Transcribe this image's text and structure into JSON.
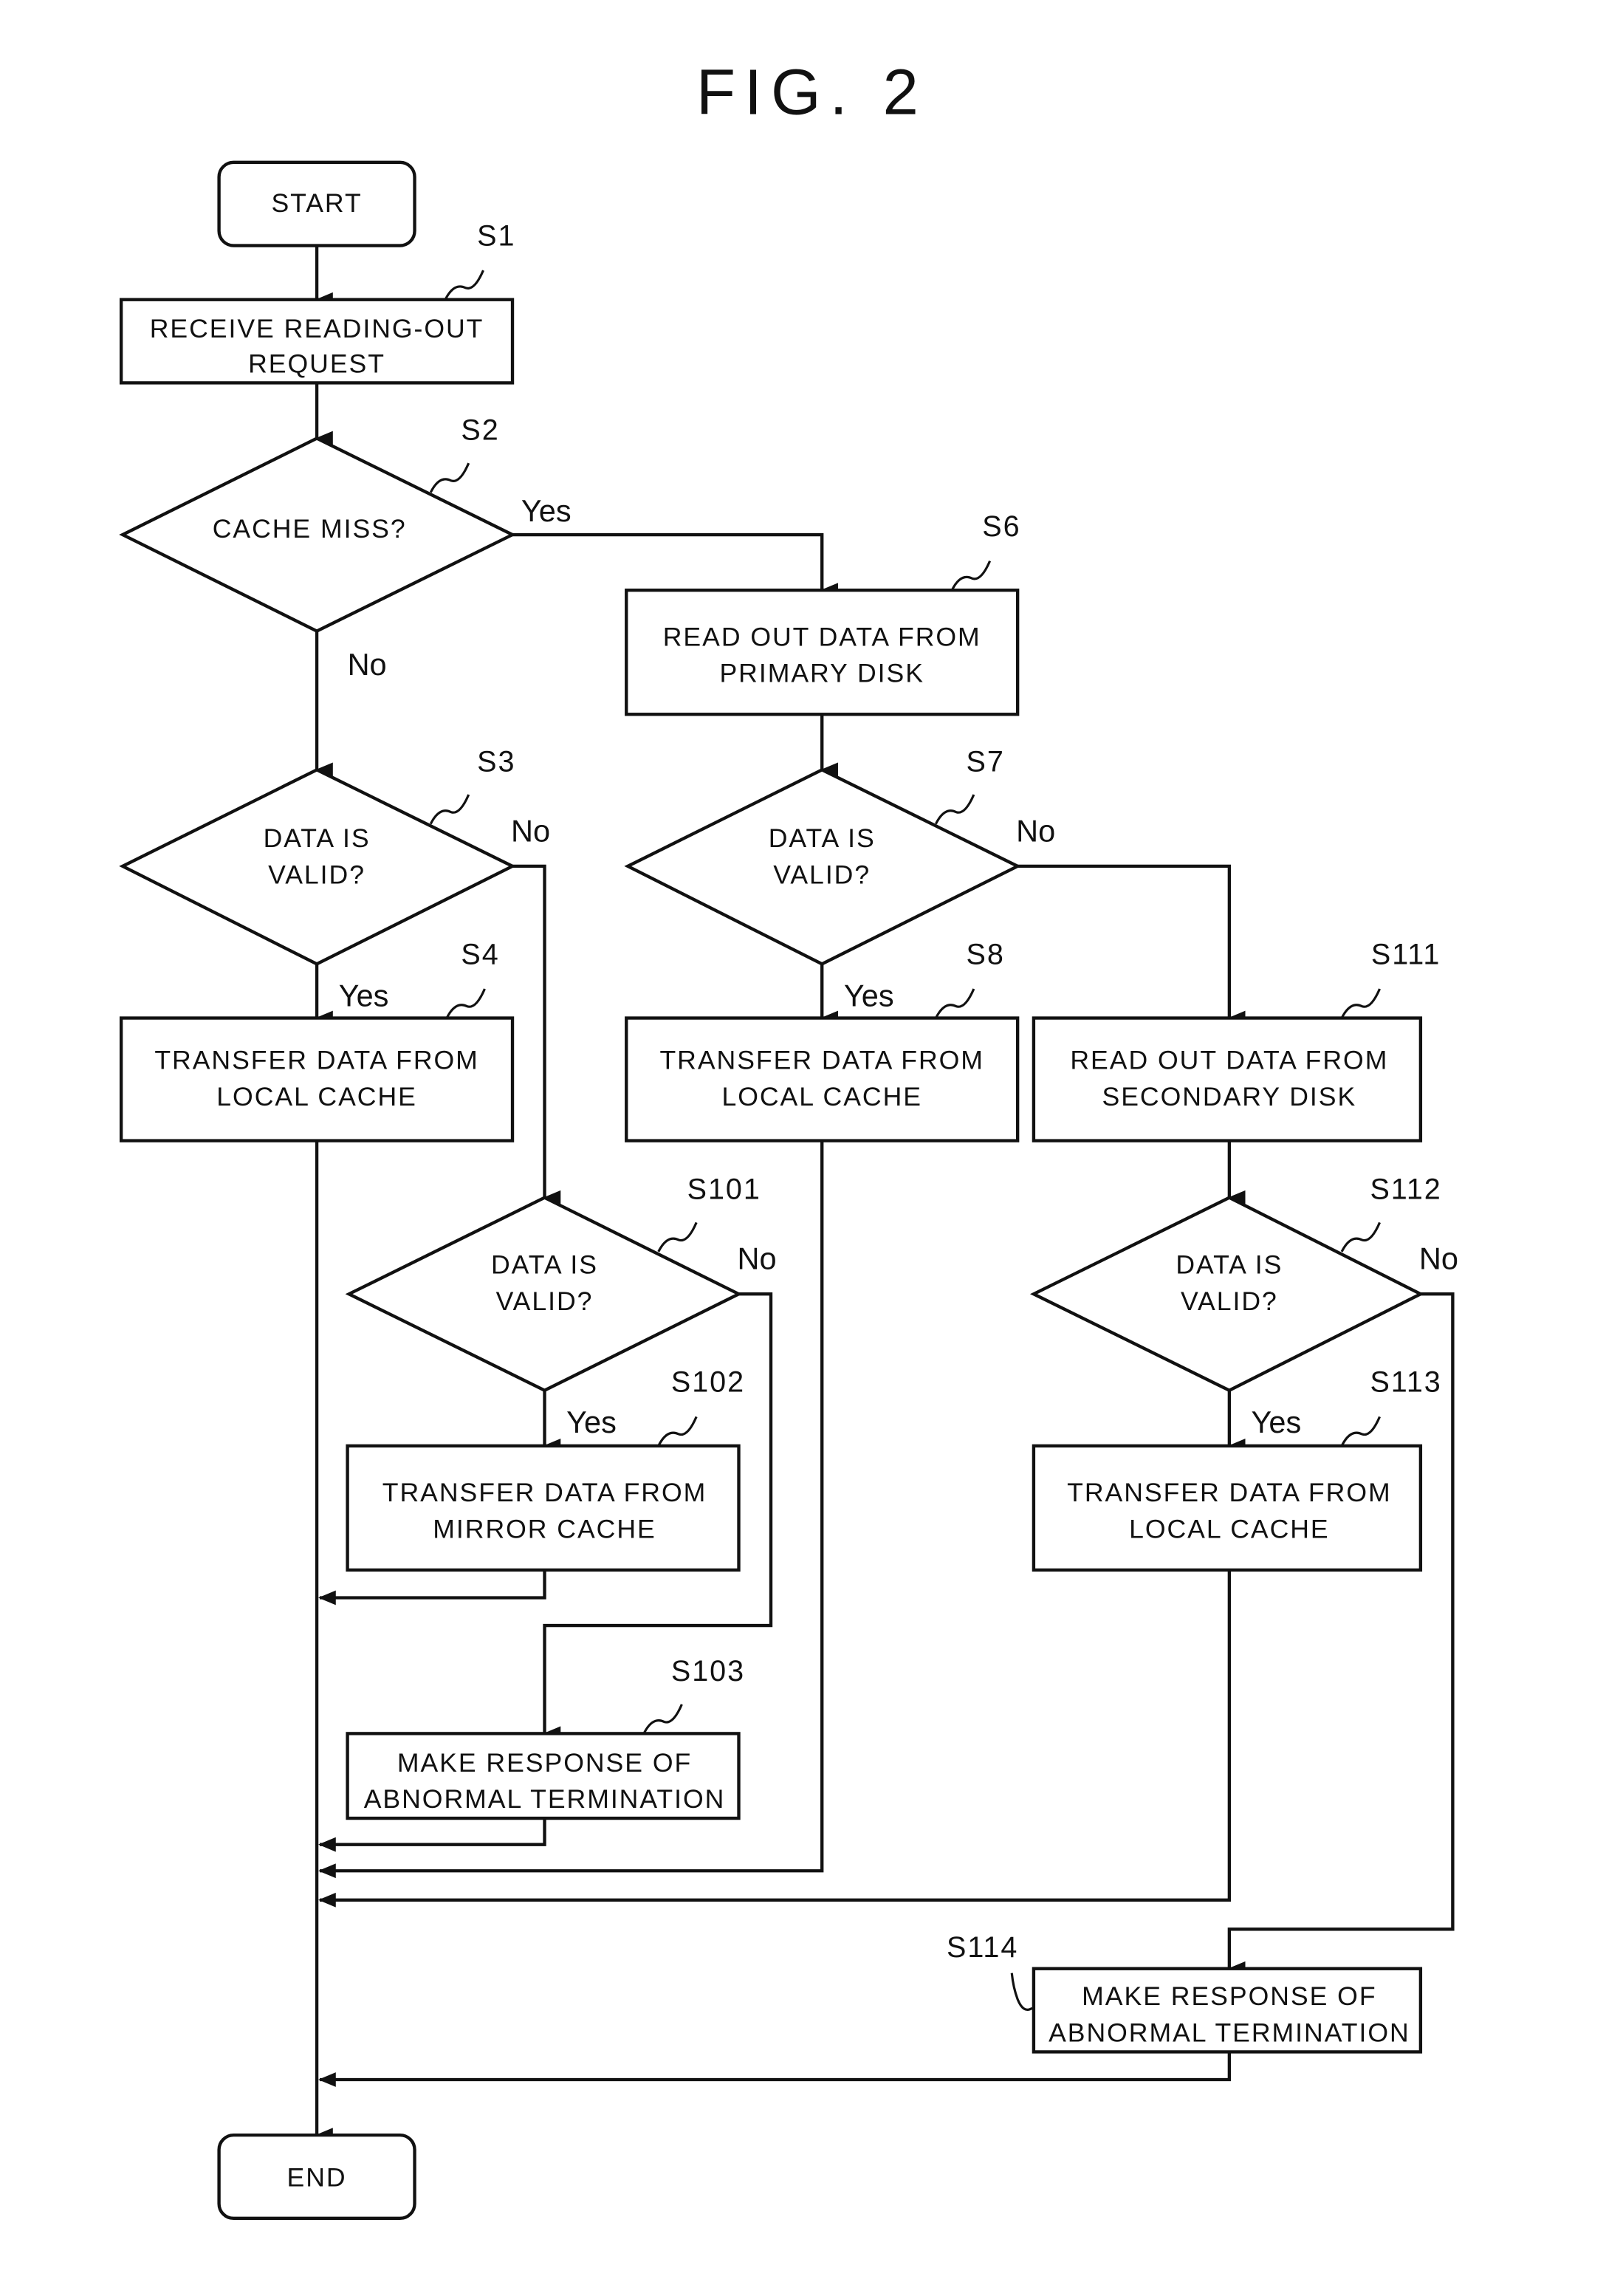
{
  "figure": {
    "title": "FIG. 2"
  },
  "nodes": {
    "start": {
      "label": [
        "START"
      ]
    },
    "s1": {
      "step": "S1",
      "label": [
        "RECEIVE READING-OUT",
        "REQUEST"
      ]
    },
    "s2": {
      "step": "S2",
      "label": [
        "CACHE MISS?"
      ]
    },
    "s3": {
      "step": "S3",
      "label": [
        "DATA IS",
        "VALID?"
      ]
    },
    "s4": {
      "step": "S4",
      "label": [
        "TRANSFER DATA FROM",
        "LOCAL CACHE"
      ]
    },
    "s6": {
      "step": "S6",
      "label": [
        "READ OUT DATA FROM",
        "PRIMARY DISK"
      ]
    },
    "s7": {
      "step": "S7",
      "label": [
        "DATA IS",
        "VALID?"
      ]
    },
    "s8": {
      "step": "S8",
      "label": [
        "TRANSFER DATA FROM",
        "LOCAL CACHE"
      ]
    },
    "s101": {
      "step": "S101",
      "label": [
        "DATA IS",
        "VALID?"
      ]
    },
    "s102": {
      "step": "S102",
      "label": [
        "TRANSFER DATA FROM",
        "MIRROR CACHE"
      ]
    },
    "s103": {
      "step": "S103",
      "label": [
        "MAKE RESPONSE OF",
        "ABNORMAL TERMINATION"
      ]
    },
    "s111": {
      "step": "S111",
      "label": [
        "READ OUT DATA FROM",
        "SECONDARY DISK"
      ]
    },
    "s112": {
      "step": "S112",
      "label": [
        "DATA IS",
        "VALID?"
      ]
    },
    "s113": {
      "step": "S113",
      "label": [
        "TRANSFER DATA FROM",
        "LOCAL CACHE"
      ]
    },
    "s114": {
      "step": "S114",
      "label": [
        "MAKE RESPONSE OF",
        "ABNORMAL TERMINATION"
      ]
    },
    "end": {
      "label": [
        "END"
      ]
    }
  },
  "edges": {
    "s2_yes": "Yes",
    "s2_no": "No",
    "s3_no": "No",
    "s3_yes": "Yes",
    "s7_no": "No",
    "s7_yes": "Yes",
    "s101_no": "No",
    "s101_yes": "Yes",
    "s112_no": "No",
    "s112_yes": "Yes"
  }
}
